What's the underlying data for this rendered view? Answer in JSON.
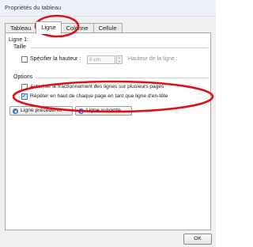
{
  "window": {
    "title": "Propriétés du tableau"
  },
  "tabs": [
    {
      "label": "Tableau",
      "active": false
    },
    {
      "label": "Ligne",
      "active": true
    },
    {
      "label": "Colonne",
      "active": false
    },
    {
      "label": "Cellule",
      "active": false
    }
  ],
  "row_panel": {
    "row_heading": "Ligne 1:",
    "size_heading": "Taille",
    "specify_height": {
      "label": "Spécifier la hauteur :",
      "checked": false
    },
    "height_value": "0 cm",
    "height_mode_label": "Hauteur de la ligne :",
    "options_heading": "Options",
    "allow_break": {
      "label": "Autoriser le fractionnement des lignes sur plusieurs pages",
      "checked": false
    },
    "repeat_header": {
      "label": "Répéter en haut de chaque page en tant que ligne d'en-tête",
      "checked": true
    },
    "prev_row_button": "Ligne précédente",
    "next_row_button": "Ligne suivante"
  },
  "footer": {
    "ok_label": "OK"
  },
  "colors": {
    "annotation": "#e0101b",
    "accent": "#3b79c9"
  }
}
